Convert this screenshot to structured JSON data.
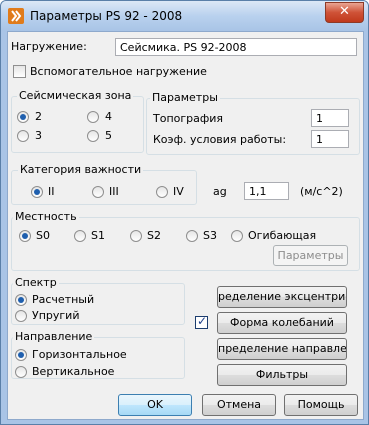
{
  "window": {
    "title": "Параметры PS 92 - 2008",
    "close_label": "✕"
  },
  "load": {
    "label": "Нагружение:",
    "value": "Сейсмика. PS 92-2008"
  },
  "aux_load": {
    "label": "Вспомогательное нагружение",
    "checked": false
  },
  "seismic_zone": {
    "title": "Сейсмическая зона",
    "options": [
      "2",
      "4",
      "3",
      "5"
    ],
    "selected": "2"
  },
  "params": {
    "title": "Параметры",
    "topography_label": "Топография",
    "topography_value": "1",
    "work_cond_label": "Коэф. условия работы:",
    "work_cond_value": "1"
  },
  "importance": {
    "title": "Категория важности",
    "options": [
      "II",
      "III",
      "IV"
    ],
    "selected": "II"
  },
  "ag": {
    "label": "ag",
    "value": "1,1",
    "unit": "(м/с^2)"
  },
  "terrain": {
    "title": "Местность",
    "options": [
      "S0",
      "S1",
      "S2",
      "S3",
      "Огибающая"
    ],
    "selected": "S0",
    "params_button": "Параметры"
  },
  "spectrum": {
    "title": "Спектр",
    "options": [
      "Расчетный",
      "Упругий"
    ],
    "selected": "Расчетный"
  },
  "direction": {
    "title": "Направление",
    "options": [
      "Горизонтальное",
      "Вертикальное"
    ],
    "selected": "Горизонтальное"
  },
  "side_buttons": {
    "eccentricity": "ределение эксцентрисит",
    "modes": "Форма колебаний",
    "directions": "пределение направлени",
    "filters": "Фильтры"
  },
  "modes_checked": true,
  "footer": {
    "ok": "OK",
    "cancel": "Отмена",
    "help": "Помощь"
  }
}
